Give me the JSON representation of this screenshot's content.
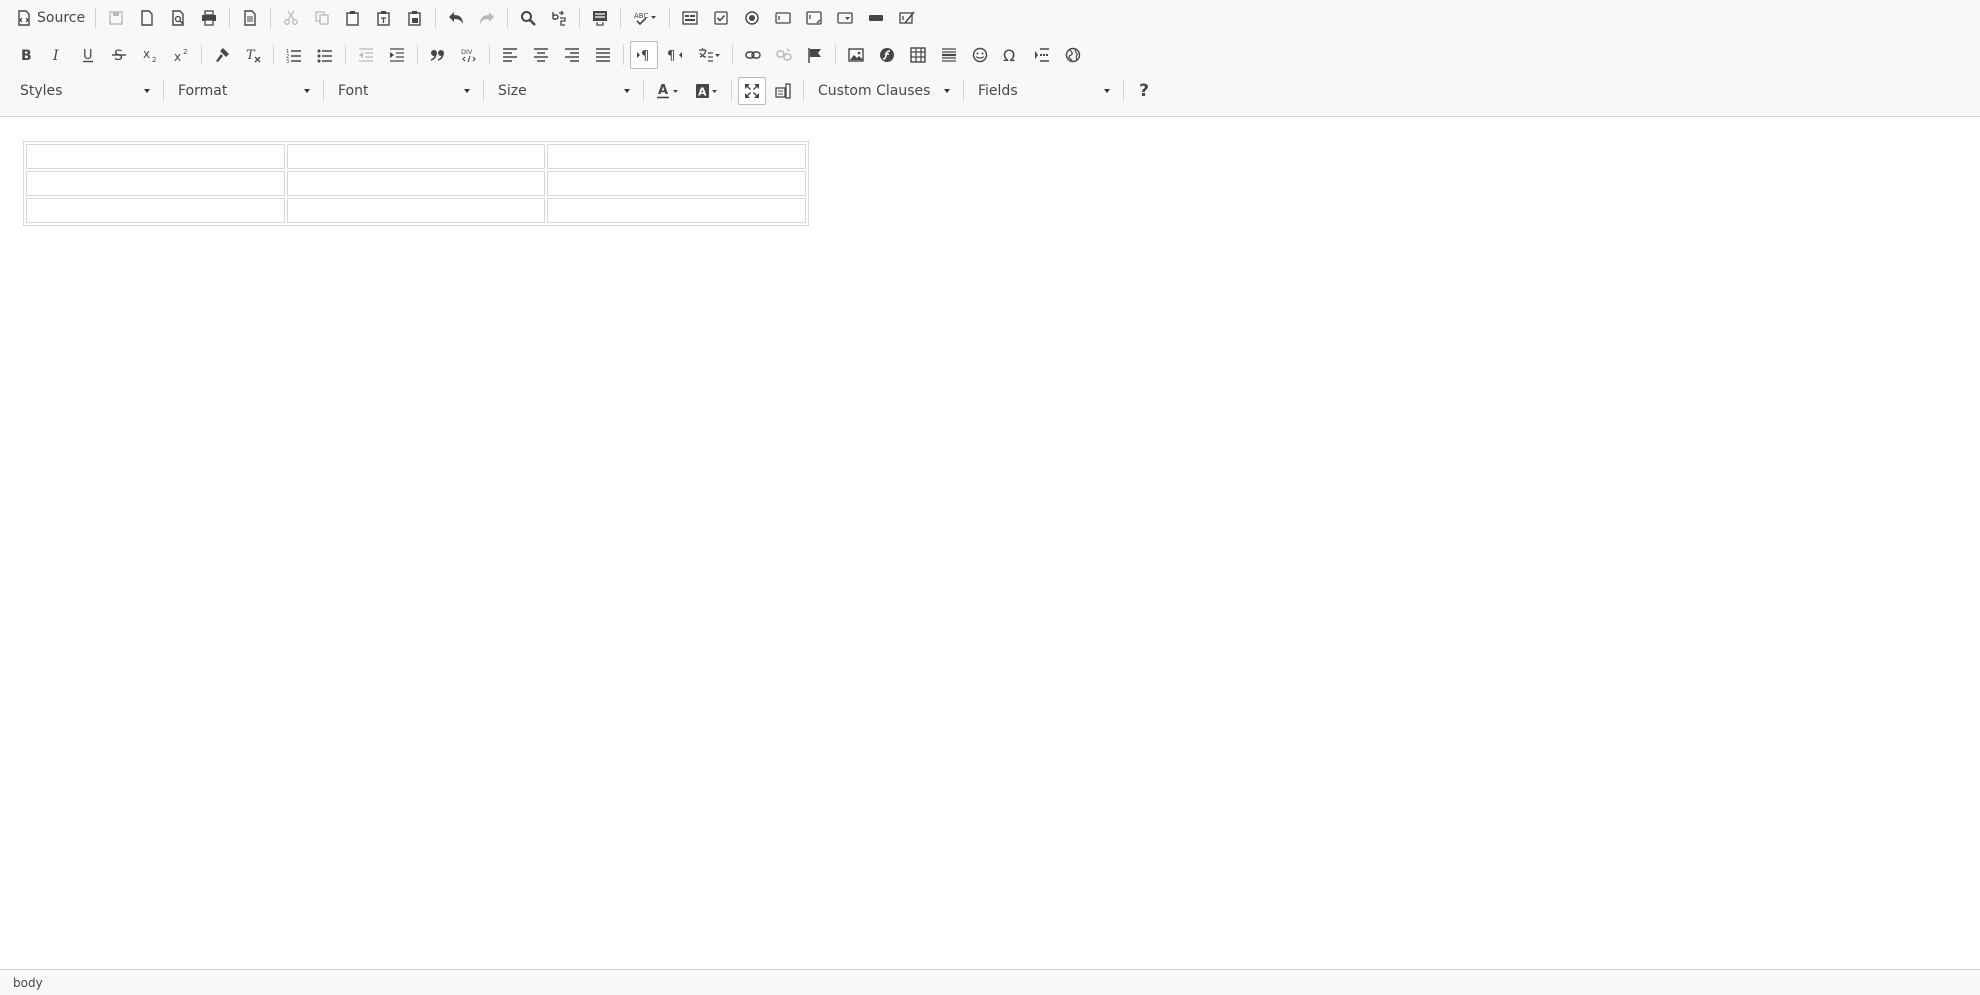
{
  "toolbar": {
    "source_label": "Source",
    "combos": {
      "styles": "Styles",
      "format": "Format",
      "font": "Font",
      "size": "Size",
      "custom_clauses": "Custom Clauses",
      "fields": "Fields"
    },
    "help_label": "?"
  },
  "editor": {
    "table": {
      "rows": 3,
      "cols": 3
    }
  },
  "status_bar": {
    "path": "body"
  }
}
